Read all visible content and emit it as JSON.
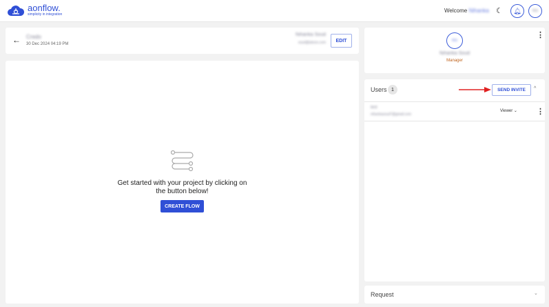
{
  "header": {
    "brand": "aonflow.",
    "tagline": "simplicity in integration",
    "welcome": "Welcome",
    "user_name": "Nihanka",
    "avatar_initials": "NS"
  },
  "project": {
    "name": "Credo",
    "date": "30 Dec 2024 04:19 PM",
    "owner_name": "Nihanka Soud",
    "owner_email": "soud@aboxx.com",
    "edit_label": "EDIT"
  },
  "empty_state": {
    "line1": "Get started with your project by clicking on",
    "line2": "the button below!",
    "create_label": "CREATE FLOW"
  },
  "profile": {
    "initials": "NS",
    "name": "Nihanka Soud",
    "role": "Manager"
  },
  "users": {
    "title": "Users",
    "count": "1",
    "send_invite_label": "SEND INVITE",
    "items": [
      {
        "name": "test",
        "email": "nihankasoud7@gmail.com",
        "role": "Viewer"
      }
    ]
  },
  "request": {
    "title": "Request"
  }
}
